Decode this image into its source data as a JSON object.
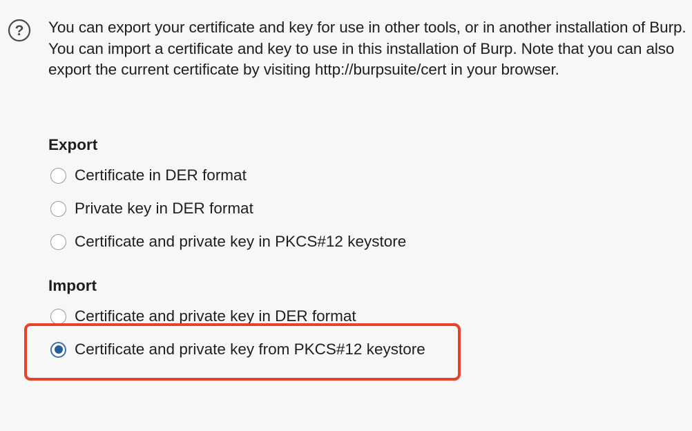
{
  "description": "You can export your certificate and key for use in other tools, or in another installation of Burp. You can import a certificate and key to use in this installation of Burp. Note that you can also export the current certificate by visiting http://burpsuite/cert in your browser.",
  "export": {
    "title": "Export",
    "options": [
      {
        "label": "Certificate in DER format",
        "selected": false
      },
      {
        "label": "Private key in DER format",
        "selected": false
      },
      {
        "label": "Certificate and private key in PKCS#12 keystore",
        "selected": false
      }
    ]
  },
  "import": {
    "title": "Import",
    "options": [
      {
        "label": "Certificate and private key in DER format",
        "selected": false
      },
      {
        "label": "Certificate and private key from PKCS#12 keystore",
        "selected": true
      }
    ]
  },
  "colors": {
    "highlight": "#e8412c",
    "radio_selected": "#2d5a98"
  },
  "icons": {
    "help": "help-icon"
  }
}
